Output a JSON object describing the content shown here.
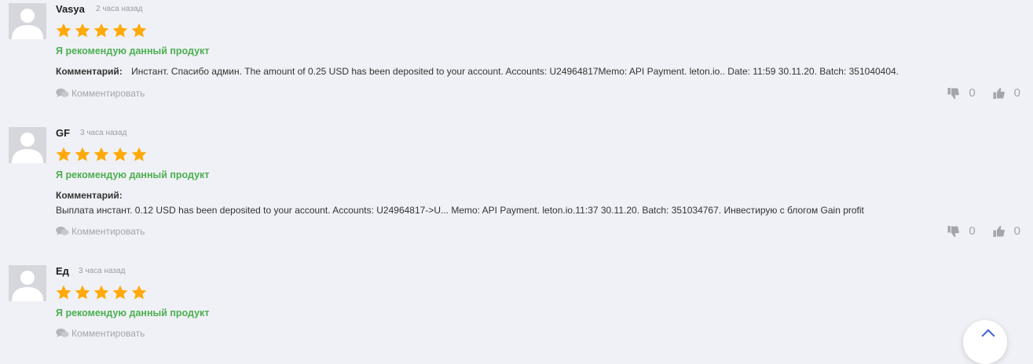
{
  "reviews": [
    {
      "author": "Vasya",
      "time": "2 часа назад",
      "rating": 5,
      "recommend": "Я рекомендую данный продукт",
      "comment_label": "Комментарий:",
      "comment_text": "Инстант. Спасибо админ. The amount of 0.25 USD has been deposited to your account. Accounts: U24964817Memo: API Payment. leton.io.. Date: 11:59 30.11.20. Batch: 351040404.",
      "reply_label": "Комментировать",
      "dislikes": "0",
      "likes": "0"
    },
    {
      "author": "GF",
      "time": "3 часа назад",
      "rating": 5,
      "recommend": "Я рекомендую данный продукт",
      "comment_label": "Комментарий:",
      "comment_text": "Выплата инстант. 0.12 USD has been deposited to your account. Accounts: U24964817->U... Memo: API Payment. leton.io.11:37 30.11.20. Batch: 351034767. Инвестирую с блогом Gain profit",
      "reply_label": "Комментировать",
      "dislikes": "0",
      "likes": "0"
    },
    {
      "author": "Ед",
      "time": "3 часа назад",
      "rating": 5,
      "recommend": "Я рекомендую данный продукт",
      "reply_label": "Комментировать"
    }
  ],
  "colors": {
    "star": "#ffa90a",
    "recommend": "#4caf50",
    "muted": "#a3a5ab",
    "background": "#f0f1f6"
  },
  "icons": {
    "avatar": "user-silhouette-icon",
    "reply": "speech-bubbles-icon",
    "dislike": "thumbs-down-icon",
    "like": "thumbs-up-icon",
    "star": "star-icon"
  }
}
